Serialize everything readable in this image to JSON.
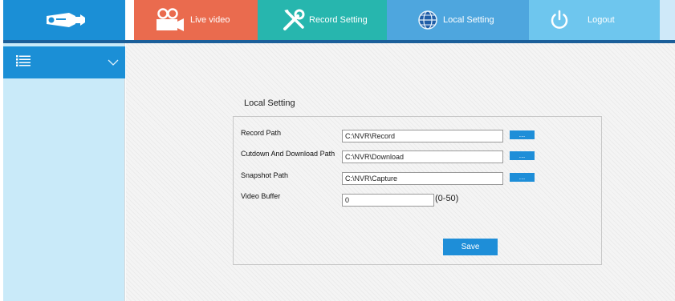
{
  "nav": {
    "logo_icon": "camera-logo-icon",
    "tabs": [
      {
        "label": "Live video",
        "icon": "video-camera-icon",
        "color": "#ea6b4e"
      },
      {
        "label": "Record Setting",
        "icon": "tools-icon",
        "color": "#27b6ae"
      },
      {
        "label": "Local Setting",
        "icon": "globe-icon",
        "color": "#4ea6de"
      },
      {
        "label": "Logout",
        "icon": "power-icon",
        "color": "#6ec6ee"
      }
    ]
  },
  "sidebar": {
    "menu_icon": "list-icon",
    "toggle_icon": "chevron-down-icon"
  },
  "local_setting": {
    "title": "Local Setting",
    "record_path": {
      "label": "Record Path",
      "value": "C:\\NVR\\Record",
      "browse_label": "..."
    },
    "download_path": {
      "label": "Cutdown And Download Path",
      "value": "C:\\NVR\\Download",
      "browse_label": "..."
    },
    "snapshot_path": {
      "label": "Snapshot Path",
      "value": "C:\\NVR\\Capture",
      "browse_label": "..."
    },
    "video_buffer": {
      "label": "Video Buffer",
      "value": "0",
      "range": "(0-50)"
    },
    "save_label": "Save"
  }
}
